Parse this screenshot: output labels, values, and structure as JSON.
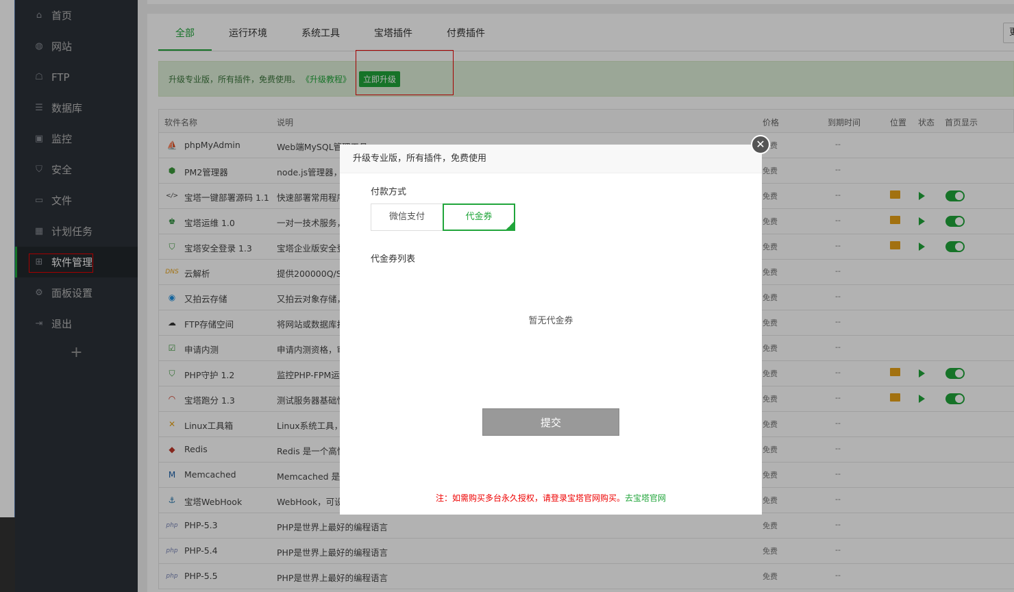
{
  "sidebar": {
    "items": [
      {
        "label": "首页",
        "icon": "home-icon",
        "glyph": "⌂"
      },
      {
        "label": "网站",
        "icon": "globe-icon",
        "glyph": "◍"
      },
      {
        "label": "FTP",
        "icon": "ftp-icon",
        "glyph": "☖"
      },
      {
        "label": "数据库",
        "icon": "database-icon",
        "glyph": "☰"
      },
      {
        "label": "监控",
        "icon": "monitor-icon",
        "glyph": "▣"
      },
      {
        "label": "安全",
        "icon": "shield-icon",
        "glyph": "⛉"
      },
      {
        "label": "文件",
        "icon": "folder-icon",
        "glyph": "▭"
      },
      {
        "label": "计划任务",
        "icon": "calendar-icon",
        "glyph": "▦"
      },
      {
        "label": "软件管理",
        "icon": "apps-icon",
        "glyph": "⊞"
      },
      {
        "label": "面板设置",
        "icon": "gear-icon",
        "glyph": "⚙"
      },
      {
        "label": "退出",
        "icon": "logout-icon",
        "glyph": "⇥"
      }
    ],
    "active_index": 8,
    "add_label": "+"
  },
  "tabs": [
    "全部",
    "运行环境",
    "系统工具",
    "宝塔插件",
    "付费插件"
  ],
  "top_right_button": "更",
  "upgrade_bar": {
    "text": "升级专业版，所有插件，免费使用。",
    "link": "《升级教程》",
    "button": "立即升级"
  },
  "table": {
    "headers": [
      "软件名称",
      "说明",
      "价格",
      "到期时间",
      "位置",
      "状态",
      "首页显示"
    ],
    "rows": [
      {
        "icon": "sailboat-icon",
        "glyph": "⛵",
        "color": "#d4861c",
        "name": "phpMyAdmin",
        "desc": "Web端MySQL管理工具",
        "price": "免费",
        "expiry": "--",
        "actions": false
      },
      {
        "icon": "pm2-icon",
        "glyph": "⬢",
        "color": "#3c9a3c",
        "name": "PM2管理器",
        "desc": "node.js管理器，",
        "price": "免费",
        "expiry": "--",
        "actions": false
      },
      {
        "icon": "code-icon",
        "glyph": "</>",
        "color": "#444",
        "name": "宝塔一键部署源码 1.1",
        "desc": "快速部署常用程序",
        "price": "免费",
        "expiry": "--",
        "actions": true
      },
      {
        "icon": "ops-icon",
        "glyph": "♚",
        "color": "#2c8f3c",
        "name": "宝塔运维 1.0",
        "desc": "一对一技术服务，",
        "price": "免费",
        "expiry": "--",
        "actions": true
      },
      {
        "icon": "lock-shield-icon",
        "glyph": "⛉",
        "color": "#3c9a3c",
        "name": "宝塔安全登录 1.3",
        "desc": "宝塔企业版安全登",
        "price": "免费",
        "expiry": "--",
        "actions": true
      },
      {
        "icon": "dns-icon",
        "glyph": "DNS",
        "color": "#e8a317",
        "name": "云解析",
        "desc": "提供200000Q/S",
        "price": "免费",
        "expiry": "--",
        "actions": false
      },
      {
        "icon": "upyun-icon",
        "glyph": "◉",
        "color": "#1a8fe0",
        "name": "又拍云存储",
        "desc": "又拍云对象存储，",
        "price": "免费",
        "expiry": "--",
        "actions": false
      },
      {
        "icon": "cloud-ftp-icon",
        "glyph": "☁",
        "color": "#333",
        "name": "FTP存储空间",
        "desc": "将网站或数据库打",
        "price": "免费",
        "expiry": "--",
        "actions": false
      },
      {
        "icon": "checklist-icon",
        "glyph": "☑",
        "color": "#3c9a3c",
        "name": "申请内测",
        "desc": "申请内测资格，审",
        "price": "免费",
        "expiry": "--",
        "actions": false
      },
      {
        "icon": "php-shield-icon",
        "glyph": "⛉",
        "color": "#3c9a3c",
        "name": "PHP守护 1.2",
        "desc": "监控PHP-FPM运",
        "price": "免费",
        "expiry": "--",
        "actions": true
      },
      {
        "icon": "speedometer-icon",
        "glyph": "◠",
        "color": "#d0321c",
        "name": "宝塔跑分 1.3",
        "desc": "测试服务器基础性",
        "price": "免费",
        "expiry": "--",
        "actions": true
      },
      {
        "icon": "tools-icon",
        "glyph": "✕",
        "color": "#e8a317",
        "name": "Linux工具箱",
        "desc": "Linux系统工具，",
        "price": "免费",
        "expiry": "--",
        "actions": false
      },
      {
        "icon": "redis-icon",
        "glyph": "◆",
        "color": "#c0392b",
        "name": "Redis",
        "desc": "Redis 是一个高性",
        "price": "免费",
        "expiry": "--",
        "actions": false
      },
      {
        "icon": "memcached-icon",
        "glyph": "M",
        "color": "#1a5fa8",
        "name": "Memcached",
        "desc": "Memcached 是一",
        "price": "免费",
        "expiry": "--",
        "actions": false
      },
      {
        "icon": "anchor-icon",
        "glyph": "⚓",
        "color": "#1a6fa8",
        "name": "宝塔WebHook",
        "desc": "WebHook，可设",
        "price": "免费",
        "expiry": "--",
        "actions": false
      },
      {
        "icon": "php-icon",
        "glyph": "php",
        "color": "#7a86b8",
        "name": "PHP-5.3",
        "desc": "PHP是世界上最好的编程语言",
        "price": "免费",
        "expiry": "--",
        "actions": false
      },
      {
        "icon": "php-icon",
        "glyph": "php",
        "color": "#7a86b8",
        "name": "PHP-5.4",
        "desc": "PHP是世界上最好的编程语言",
        "price": "免费",
        "expiry": "--",
        "actions": false
      },
      {
        "icon": "php-icon",
        "glyph": "php",
        "color": "#7a86b8",
        "name": "PHP-5.5",
        "desc": "PHP是世界上最好的编程语言",
        "price": "免费",
        "expiry": "--",
        "actions": false
      }
    ]
  },
  "modal": {
    "title": "升级专业版，所有插件，免费使用",
    "pay_method_label": "付款方式",
    "pay_options": [
      "微信支付",
      "代金券"
    ],
    "selected_pay": "代金券",
    "voucher_list_label": "代金券列表",
    "empty_text": "暂无代金券",
    "submit_label": "提交",
    "note_text": "注：如需购买多台永久授权，请登录宝塔官网购买。",
    "note_link": "去宝塔官网",
    "close_glyph": "✕"
  },
  "colors": {
    "accent": "#20a53a",
    "sidebar_bg": "#2c3138",
    "warning": "#e00000"
  }
}
